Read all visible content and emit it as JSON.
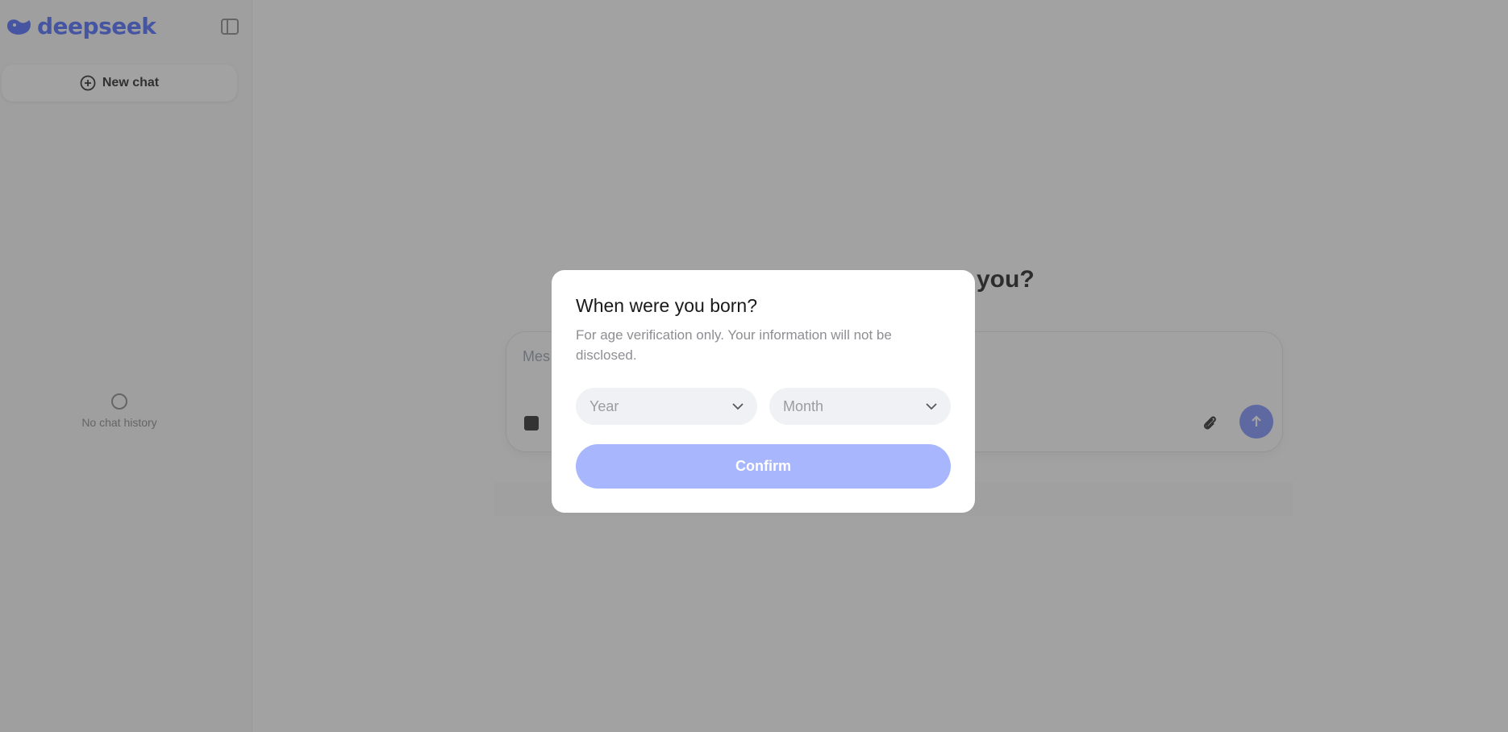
{
  "sidebar": {
    "logo_text": "deepseek",
    "new_chat_label": "New chat",
    "history_empty_text": "No chat history"
  },
  "main": {
    "greeting_visible": "you?",
    "composer_placeholder": "Mes"
  },
  "modal": {
    "title": "When were you born?",
    "description": "For age verification only. Your information will not be disclosed.",
    "year_placeholder": "Year",
    "month_placeholder": "Month",
    "confirm_label": "Confirm"
  },
  "colors": {
    "brand": "#4d6bfe",
    "confirm_disabled": "#a8b6fe",
    "overlay": "rgba(60,60,60,0.48)"
  },
  "icons": {
    "logo": "whale-logo-icon",
    "collapse": "sidebar-toggle-icon",
    "new_chat": "plus-circle-icon",
    "loading": "loading-circle-icon",
    "attach": "paperclip-icon",
    "send": "arrow-up-icon",
    "select_chevron": "chevron-down-icon"
  }
}
